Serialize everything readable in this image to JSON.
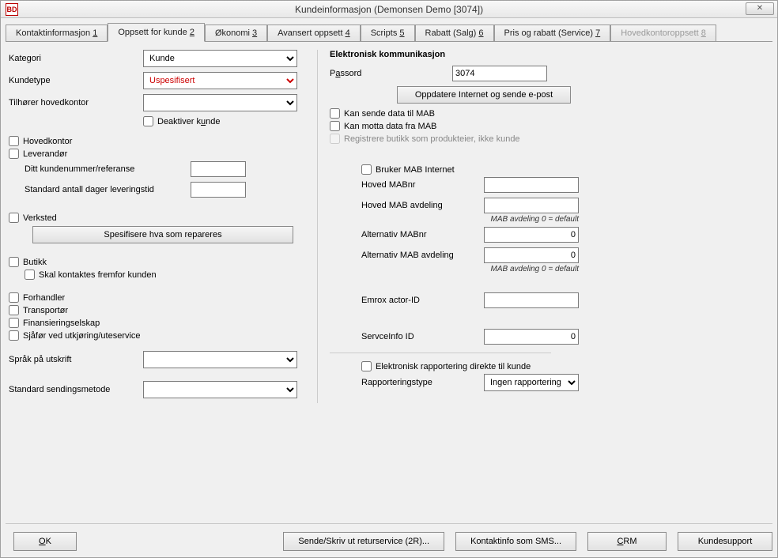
{
  "window": {
    "title": "Kundeinformasjon (Demonsen Demo [3074])",
    "icon_text": "BD"
  },
  "tabs": [
    {
      "label": "Kontaktinformasjon ",
      "accel": "1",
      "active": false,
      "disabled": false
    },
    {
      "label": "Oppsett for kunde ",
      "accel": "2",
      "active": true,
      "disabled": false
    },
    {
      "label": "Økonomi ",
      "accel": "3",
      "active": false,
      "disabled": false
    },
    {
      "label": "Avansert oppsett ",
      "accel": "4",
      "active": false,
      "disabled": false
    },
    {
      "label": "Scripts ",
      "accel": "5",
      "active": false,
      "disabled": false
    },
    {
      "label": "Rabatt (Salg) ",
      "accel": "6",
      "active": false,
      "disabled": false
    },
    {
      "label": "Pris og rabatt (Service) ",
      "accel": "7",
      "active": false,
      "disabled": false
    },
    {
      "label": "Hovedkontoroppsett ",
      "accel": "8",
      "active": false,
      "disabled": true
    }
  ],
  "left": {
    "kategori_label": "Kategori",
    "kategori_value": "Kunde",
    "kundetype_label": "Kundetype",
    "kundetype_value": "Uspesifisert",
    "tilhorer_label": "Tilhører hovedkontor",
    "tilhorer_value": "",
    "deaktiver_label": "Deaktiver k",
    "deaktiver_accel": "u",
    "deaktiver_suffix": "nde",
    "hovedkontor_label": "Hovedkontor",
    "leverandor_label": "Leverandør",
    "lev_kundenr_label": "Ditt kundenummer/referanse",
    "lev_kundenr_value": "",
    "lev_dager_label": "Standard antall dager leveringstid",
    "lev_dager_value": "",
    "verksted_label": "Verksted",
    "verksted_btn": "Spesifisere hva som repareres",
    "butikk_label": "Butikk",
    "butikk_contact_label": "Skal kontaktes fremfor kunden",
    "forhandler_label": "Forhandler",
    "transportor_label": "Transportør",
    "finansiering_label": "Finansieringselskap",
    "sjafor_label": "Sjåfør ved utkjøring/uteservice",
    "sprak_label": "Språk på utskrift",
    "sprak_value": "",
    "sendingsmetode_label": "Standard sendingsmetode",
    "sendingsmetode_value": ""
  },
  "right": {
    "header": "Elektronisk kommunikasjon",
    "passord_prefix": "P",
    "passord_accel": "a",
    "passord_suffix": "ssord",
    "passord_value": "3074",
    "oppdatere_btn": "Oppdatere Internet og sende e-post",
    "kan_sende_label": "Kan sende data til MAB",
    "kan_motta_label": "Kan motta data fra MAB",
    "registrere_label": "Registrere butikk som produkteier, ikke kunde",
    "bruker_mab_label": "Bruker MAB Internet",
    "hoved_mabnr_label": "Hoved MABnr",
    "hoved_mabnr_value": "",
    "hoved_mab_avd_label": "Hoved MAB avdeling",
    "hoved_mab_avd_value": "",
    "mab_hint": "MAB avdeling 0 = default",
    "alt_mabnr_label": "Alternativ MABnr",
    "alt_mabnr_value": "0",
    "alt_mab_avd_label": "Alternativ MAB avdeling",
    "alt_mab_avd_value": "0",
    "emrox_label": "Emrox actor-ID",
    "emrox_value": "",
    "serviceinfo_label": "ServceInfo ID",
    "serviceinfo_value": "0",
    "elektronisk_rapp_label": "Elektronisk rapportering direkte til kunde",
    "rapporteringstype_label": "Rapporteringstype",
    "rapporteringstype_value": "Ingen rapportering"
  },
  "bottom": {
    "ok_prefix": "",
    "ok_accel": "O",
    "ok_suffix": "K",
    "retur_btn": "Sende/Skriv ut returservice (2R)...",
    "sms_btn": "Kontaktinfo som SMS...",
    "crm_prefix": "",
    "crm_accel": "C",
    "crm_suffix": "RM",
    "support_btn": "Kundesupport"
  }
}
